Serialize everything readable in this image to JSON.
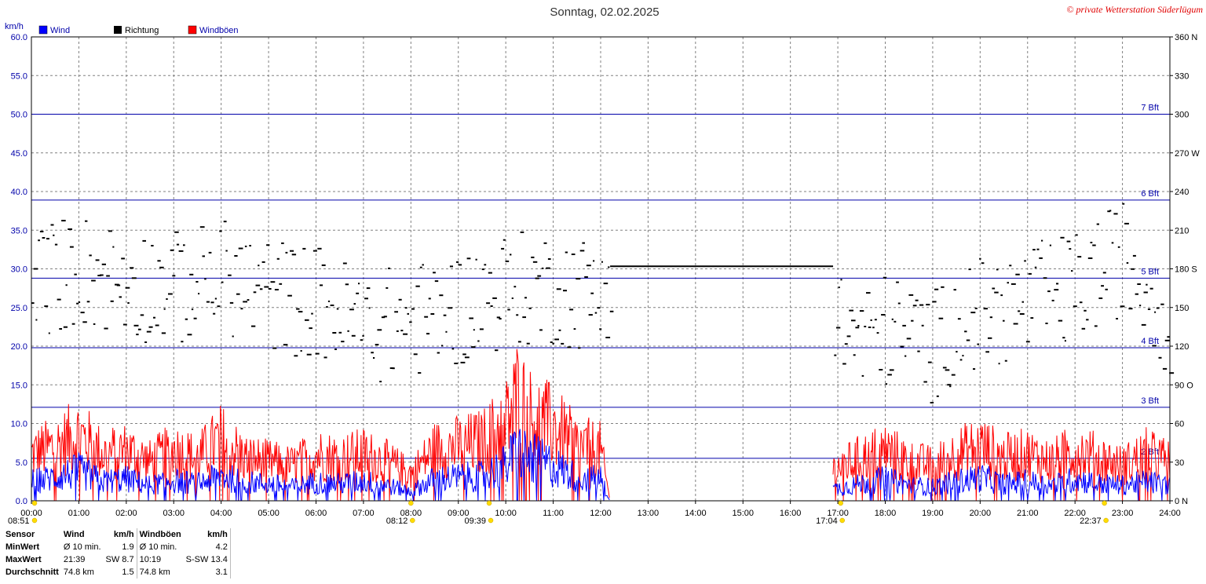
{
  "title": "Sonntag, 02.02.2025",
  "copyright": "© private Wetterstation Süderlügum",
  "y_left_unit": "km/h",
  "legend": [
    {
      "label": "Wind",
      "color": "#0000ff"
    },
    {
      "label": "Richtung",
      "color": "#000000"
    },
    {
      "label": "Windböen",
      "color": "#ff0000"
    }
  ],
  "colors": {
    "wind": "#0000ff",
    "gust": "#ff0000",
    "direction": "#000000",
    "grid": "#808080",
    "bft": "#0000aa",
    "label_blue": "#0000aa"
  },
  "chart_data": {
    "type": "line",
    "xlabel": "",
    "ylabel": "km/h",
    "xlim": [
      0,
      24
    ],
    "ylim": [
      0,
      60
    ],
    "y2lim": [
      0,
      360
    ],
    "x_ticks": [
      "00:00",
      "01:00",
      "02:00",
      "03:00",
      "04:00",
      "05:00",
      "06:00",
      "07:00",
      "08:00",
      "09:00",
      "10:00",
      "11:00",
      "12:00",
      "13:00",
      "14:00",
      "15:00",
      "16:00",
      "17:00",
      "18:00",
      "19:00",
      "20:00",
      "21:00",
      "22:00",
      "23:00",
      "24:00"
    ],
    "y_ticks": [
      "0.0",
      "5.0",
      "10.0",
      "15.0",
      "20.0",
      "25.0",
      "30.0",
      "35.0",
      "40.0",
      "45.0",
      "50.0",
      "55.0",
      "60.0"
    ],
    "y2_ticks": [
      {
        "v": 0,
        "label": "0 N"
      },
      {
        "v": 30,
        "label": "30"
      },
      {
        "v": 60,
        "label": "60"
      },
      {
        "v": 90,
        "label": "90 O"
      },
      {
        "v": 120,
        "label": "120"
      },
      {
        "v": 150,
        "label": "150"
      },
      {
        "v": 180,
        "label": "180 S"
      },
      {
        "v": 210,
        "label": "210"
      },
      {
        "v": 240,
        "label": "240"
      },
      {
        "v": 270,
        "label": "270 W"
      },
      {
        "v": 300,
        "label": "300"
      },
      {
        "v": 330,
        "label": "330"
      },
      {
        "v": 360,
        "label": "360 N"
      }
    ],
    "beaufort_lines": [
      {
        "label": "2 Bft",
        "value": 5.5
      },
      {
        "label": "3 Bft",
        "value": 12.1
      },
      {
        "label": "4 Bft",
        "value": 19.8
      },
      {
        "label": "5 Bft",
        "value": 28.8
      },
      {
        "label": "6 Bft",
        "value": 38.9
      },
      {
        "label": "7 Bft",
        "value": 50.0
      }
    ],
    "series": [
      {
        "name": "Wind",
        "x": [
          0,
          0.5,
          1,
          1.5,
          2,
          2.5,
          3,
          3.5,
          4,
          4.5,
          5,
          5.5,
          6,
          6.5,
          7,
          7.5,
          8,
          8.5,
          9,
          9.5,
          10,
          10.25,
          10.5,
          11,
          11.5,
          12,
          12.2,
          16.9,
          17.5,
          18,
          18.5,
          19,
          19.5,
          20,
          20.5,
          21,
          21.5,
          22,
          22.5,
          23,
          23.5,
          24
        ],
        "values": [
          2.5,
          3.0,
          3.8,
          2.5,
          2.8,
          2.0,
          2.6,
          2.2,
          3.2,
          2.4,
          2.2,
          1.8,
          2.4,
          2.2,
          2.5,
          2.0,
          1.2,
          2.8,
          3.0,
          3.2,
          4.5,
          6.5,
          5.5,
          4.5,
          3.0,
          2.8,
          0,
          1.5,
          2.2,
          2.8,
          2.0,
          1.8,
          2.5,
          3.0,
          2.2,
          2.5,
          2.0,
          2.8,
          2.2,
          2.0,
          2.5,
          2.0
        ]
      },
      {
        "name": "Windböen",
        "x": [
          0,
          0.5,
          1,
          1.5,
          2,
          2.5,
          3,
          3.5,
          4,
          4.5,
          5,
          5.5,
          6,
          6.5,
          7,
          7.5,
          8,
          8.5,
          9,
          9.5,
          10,
          10.25,
          10.5,
          11,
          11.5,
          12,
          12.2,
          16.9,
          17.5,
          18,
          18.5,
          19,
          19.5,
          20,
          20.5,
          21,
          21.5,
          22,
          22.5,
          23,
          23.5,
          24
        ],
        "values": [
          6.0,
          7.0,
          8.5,
          6.0,
          6.5,
          5.0,
          6.5,
          5.5,
          8.0,
          5.5,
          5.0,
          4.5,
          6.0,
          5.5,
          6.0,
          5.0,
          3.5,
          6.5,
          7.0,
          7.5,
          10.0,
          13.4,
          11.0,
          9.5,
          7.0,
          6.5,
          0,
          4.0,
          5.5,
          6.5,
          5.0,
          4.5,
          6.0,
          7.0,
          5.5,
          6.0,
          5.0,
          6.5,
          5.5,
          4.5,
          6.0,
          5.0
        ]
      },
      {
        "name": "Richtung",
        "axis": "right",
        "x": [
          0,
          1,
          2,
          3,
          4,
          5,
          6,
          7,
          8,
          9,
          10,
          11,
          12,
          12.2,
          16.9,
          17.5,
          18,
          18.5,
          19,
          19.5,
          20,
          20.5,
          21,
          22,
          23,
          24
        ],
        "values": [
          170,
          180,
          170,
          165,
          175,
          160,
          155,
          135,
          140,
          150,
          165,
          165,
          160,
          182,
          140,
          125,
          133,
          128,
          120,
          140,
          145,
          150,
          155,
          165,
          190,
          140
        ]
      }
    ],
    "sun_markers": [
      {
        "time": "08:51",
        "x": 0.0
      },
      {
        "time": "08:12",
        "x": 8.0
      },
      {
        "time": "09:39",
        "x": 9.65
      },
      {
        "time": "17:04",
        "x": 17.06
      },
      {
        "time": "22:37",
        "x": 22.62
      }
    ]
  },
  "stats": {
    "header": [
      "Sensor",
      "Wind",
      "km/h",
      "Windböen",
      "km/h"
    ],
    "rows": [
      [
        "MinWert",
        "Ø 10 min.",
        "1.9",
        "Ø 10 min.",
        "4.2"
      ],
      [
        "MaxWert",
        "21:39",
        "SW 8.7",
        "10:19",
        "S-SW 13.4"
      ],
      [
        "Durchschnitt",
        "74.8 km",
        "1.5",
        "74.8 km",
        "3.1"
      ]
    ]
  }
}
